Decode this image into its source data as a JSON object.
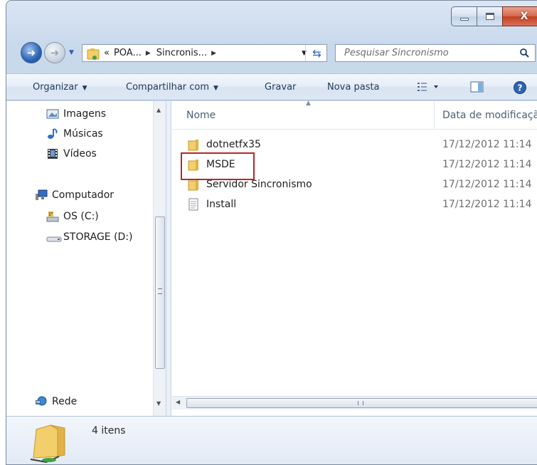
{
  "window": {
    "caption_buttons": {
      "minimize": "minimize",
      "maximize": "maximize",
      "close": "X"
    },
    "accent_close": "#c2401f"
  },
  "nav": {
    "back_icon": "back-arrow-icon",
    "forward_icon": "forward-arrow-icon",
    "address": {
      "overflow": "«",
      "crumbs": [
        "POA...",
        "Sincronis..."
      ]
    },
    "search_placeholder": "Pesquisar Sincronismo"
  },
  "toolbar": {
    "organize": "Organizar",
    "share": "Compartilhar com",
    "burn": "Gravar",
    "new_folder": "Nova pasta"
  },
  "sidebar": {
    "items": [
      {
        "label": "Imagens",
        "icon": "pictures-icon"
      },
      {
        "label": "Músicas",
        "icon": "music-icon"
      },
      {
        "label": "Vídeos",
        "icon": "videos-icon"
      },
      {
        "label": "Computador",
        "icon": "computer-icon"
      },
      {
        "label": "OS (C:)",
        "icon": "drive-c-icon"
      },
      {
        "label": "STORAGE (D:)",
        "icon": "drive-d-icon"
      },
      {
        "label": "Rede",
        "icon": "network-icon"
      }
    ]
  },
  "files": {
    "columns": {
      "name": "Nome",
      "date": "Data de modificaçã"
    },
    "rows": [
      {
        "name": "dotnetfx35",
        "date": "17/12/2012 11:14",
        "type": "folder"
      },
      {
        "name": "MSDE",
        "date": "17/12/2012 11:14",
        "type": "folder"
      },
      {
        "name": "Servidor Sincronismo",
        "date": "17/12/2012 11:14",
        "type": "folder"
      },
      {
        "name": "Install",
        "date": "17/12/2012 11:14",
        "type": "file"
      }
    ],
    "highlighted": "MSDE"
  },
  "details": {
    "count": "4 itens"
  }
}
